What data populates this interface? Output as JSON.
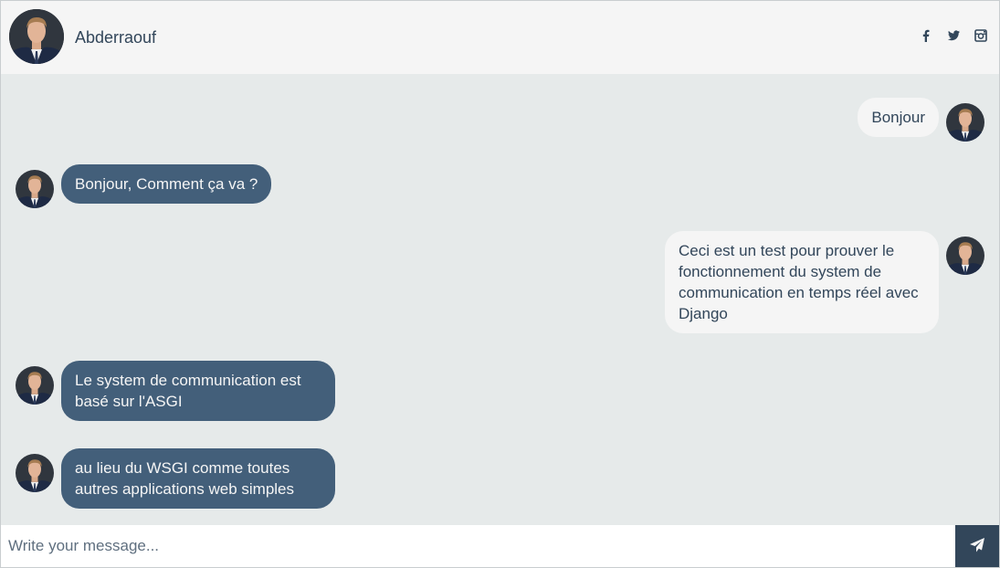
{
  "header": {
    "name": "Abderraouf",
    "avatar_icon": "user-avatar",
    "socials": [
      "facebook-icon",
      "twitter-icon",
      "instagram-icon"
    ]
  },
  "messages": [
    {
      "side": "sent",
      "text": "Bonjour"
    },
    {
      "side": "replied",
      "text": "Bonjour, Comment ça va ?"
    },
    {
      "side": "sent",
      "text": "Ceci est un test pour prouver le fonctionnement du system de communication en temps réel avec Django"
    },
    {
      "side": "replied",
      "text": "Le system de communication est basé sur l'ASGI"
    },
    {
      "side": "replied",
      "text": "au lieu du WSGI comme toutes autres applications web simples"
    }
  ],
  "composer": {
    "placeholder": "Write your message...",
    "send_icon": "paper-plane-icon"
  },
  "colors": {
    "sent_bubble": "#f5f5f5",
    "replied_bubble": "#435f7a",
    "background": "#e6eaea",
    "send_button": "#32465a"
  }
}
